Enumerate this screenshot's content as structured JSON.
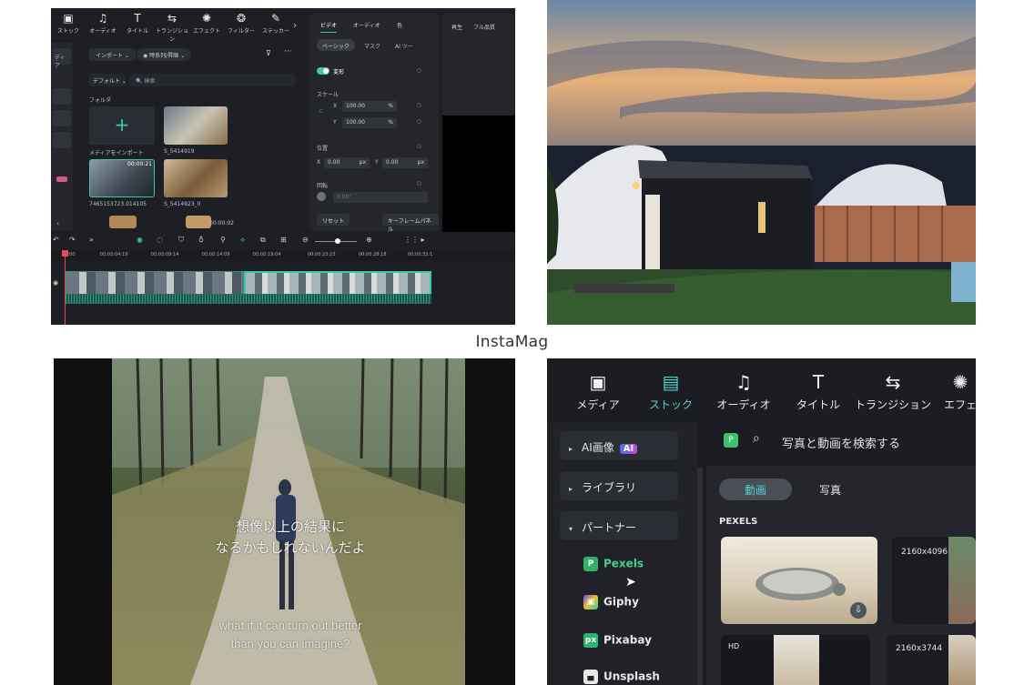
{
  "collage_label": "InstaMag",
  "editor": {
    "toolbar": [
      "ストック",
      "オーディオ",
      "タイトル",
      "トランジション",
      "エフェクト",
      "フィルター",
      "ステッカー"
    ],
    "side_label": "ディア",
    "import_label": "インポート",
    "filter_label": "時系列/昇順",
    "default_label": "デフォルト",
    "search_placeholder": "検索",
    "folder_label": "フォルダ",
    "thumb_labels": [
      "メディアをインポート",
      "S_5414919",
      "7465153723.014105",
      "S_5414923_0"
    ],
    "thumb_times": [
      "00:00:21",
      "00:00:02"
    ],
    "props_tabs": [
      "ビデオ",
      "オーディオ",
      "色"
    ],
    "sub_tabs": [
      "ベーシック",
      "マスク",
      "AI ツー"
    ],
    "transform_label": "変形",
    "scale_label": "スケール",
    "scale_x": "100.00",
    "scale_y": "100.00",
    "percent": "%",
    "position_label": "位置",
    "pos_x": "0.00",
    "pos_y": "0.00",
    "px": "px",
    "rotation_label": "回転",
    "rotation_value": "0.00°",
    "reset_label": "リセット",
    "keyframe_label": "キーフレームパネル",
    "preview_tabs": [
      "再生",
      "フル品質"
    ],
    "ruler": [
      "00:00",
      "00:00:04:19",
      "00:00:09:14",
      "00:00:14:09",
      "00:00:19:04",
      "00:00:23:23",
      "00:00:28:18",
      "00:00:33:1"
    ]
  },
  "subtitles": {
    "jp_line1": "想像以上の結果に",
    "jp_line2": "なるかもしれないんだよ",
    "en_line1": "what if it can turn out better",
    "en_line2": "than you can imagine?"
  },
  "stock": {
    "tabs": [
      "メディア",
      "ストック",
      "オーディオ",
      "タイトル",
      "トランジション",
      "エフェ"
    ],
    "left": {
      "ai_image": "AI画像",
      "ai_badge": "AI",
      "library": "ライブラリ",
      "partner": "パートナー",
      "partners": [
        "Pexels",
        "Giphy",
        "Pixabay",
        "Unsplash"
      ]
    },
    "search_placeholder": "写真と動画を検索する",
    "seg_video": "動画",
    "seg_photo": "写真",
    "section": "PEXELS",
    "hd": "HD",
    "res1": "2160x4096",
    "res2": "2160x3744"
  },
  "colors": {
    "accent": "#3ec6a8",
    "stock_active": "#4fd4d0"
  }
}
